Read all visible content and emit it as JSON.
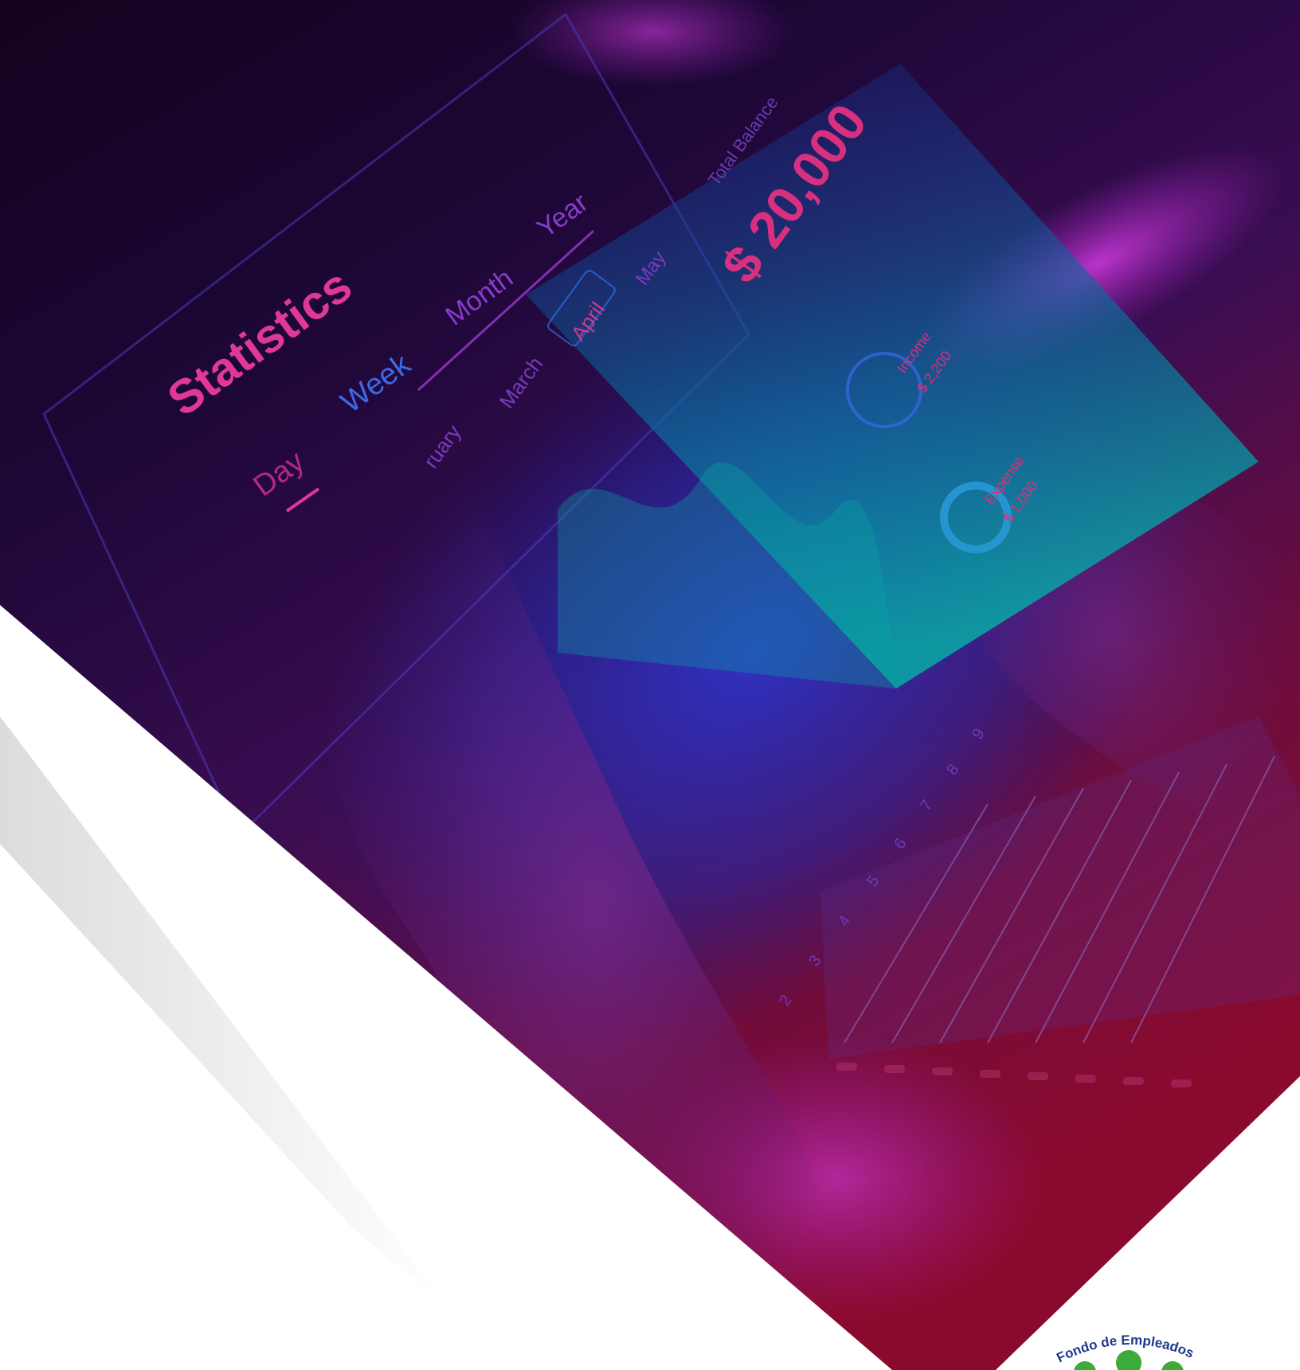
{
  "colors": {
    "background": "#ffffff",
    "deep_purple": "#1a0628",
    "navy": "#0d0a4a",
    "royal_blue": "#2a2fb8",
    "magenta": "#c23ad6",
    "crimson": "#8a0a2e",
    "teal": "#0aa3a3",
    "ui_pink": "#e0389a",
    "ui_blue": "#3a6ae8",
    "logo_navy": "#1d3a8a",
    "logo_green": "#3cab3a"
  },
  "tablet_ui": {
    "title": "Statistics",
    "periods": [
      "Day",
      "Week",
      "Month",
      "Year"
    ],
    "months": [
      "ruary",
      "March",
      "April",
      "May"
    ],
    "balance_label": "Total Balance",
    "balance_value": "$ 20,000",
    "income_label": "Income",
    "income_value": "$ 2,200",
    "expense_label": "Expense",
    "expense_value": "$ 1,000",
    "axis_numbers": [
      "2",
      "3",
      "4",
      "5",
      "6",
      "7",
      "8",
      "9"
    ]
  },
  "logo": {
    "text": "Fondo de Empleados"
  }
}
